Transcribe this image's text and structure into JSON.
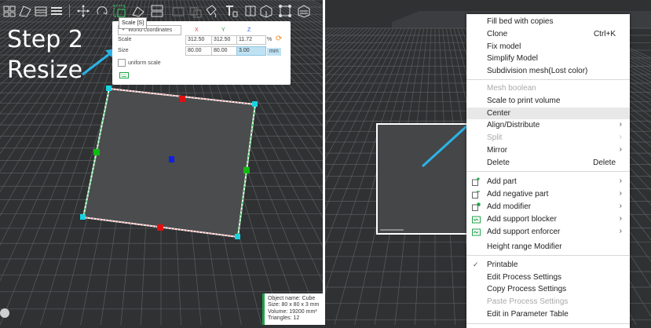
{
  "annotation": {
    "step_line1": "Step 2",
    "step_line2": "Resize"
  },
  "toolbar": {
    "icons": [
      "arrange-icon",
      "orient-icon",
      "plate-icon",
      "layers-icon",
      "move-icon",
      "rotate-icon",
      "scale-icon",
      "place-on-face-icon",
      "split-icon",
      "cut-icon",
      "boolean-icon",
      "paint-icon",
      "text-icon",
      "seam-icon",
      "support-icon",
      "assembly-icon",
      "measure-icon"
    ],
    "tooltip": "Scale [S]"
  },
  "scale_dialog": {
    "coordinates": "World coordinates",
    "axes": {
      "x": "X",
      "y": "Y",
      "z": "Z"
    },
    "axis_colors": {
      "x": "#e23c3c",
      "y": "#2a9a3a",
      "z": "#2e5fe0"
    },
    "scale_label": "Scale",
    "scale_values": {
      "x": "312.50",
      "y": "312.50",
      "z": "11.72"
    },
    "scale_unit": "%",
    "size_label": "Size",
    "size_values": {
      "x": "80.00",
      "y": "80.00",
      "z": "3.00"
    },
    "size_unit": "mm",
    "uniform_scale_label": "uniform scale",
    "uniform_scale_checked": false
  },
  "info_box": {
    "object_name": "Object name: Cube",
    "size": "Size: 80 x 80 x 3 mm",
    "volume": "Volume: 19200 mm³",
    "triangles": "Triangles: 12"
  },
  "context_menu": {
    "fill_bed": "Fill bed with copies",
    "clone": "Clone",
    "clone_shortcut": "Ctrl+K",
    "fix_model": "Fix model",
    "simplify_model": "Simplify Model",
    "subdivision_mesh": "Subdivision mesh(Lost color)",
    "mesh_boolean": "Mesh boolean",
    "scale_to_print_volume": "Scale to print volume",
    "center": "Center",
    "align_distribute": "Align/Distribute",
    "split": "Split",
    "mirror": "Mirror",
    "delete": "Delete",
    "delete_shortcut": "Delete",
    "add_part": "Add part",
    "add_negative_part": "Add negative part",
    "add_modifier": "Add modifier",
    "add_support_blocker": "Add support blocker",
    "add_support_enforcer": "Add support enforcer",
    "height_range_modifier": "Height range Modifier",
    "printable": "Printable",
    "edit_process_settings": "Edit Process Settings",
    "copy_process_settings": "Copy Process Settings",
    "paste_process_settings": "Paste Process Settings",
    "edit_in_parameter_table": "Edit in Parameter Table",
    "submenu_arrow": "›",
    "check_mark": "✓"
  },
  "colors": {
    "accent": "#2bb3e8",
    "handle_corner": "#19d3e0",
    "handle_x": "#e01010",
    "handle_y": "#11bb11",
    "handle_z": "#1020e0",
    "object_fill": "#4a4b4d",
    "grid_bg": "#2f3133",
    "modifier_dot": "#1fa34a"
  }
}
